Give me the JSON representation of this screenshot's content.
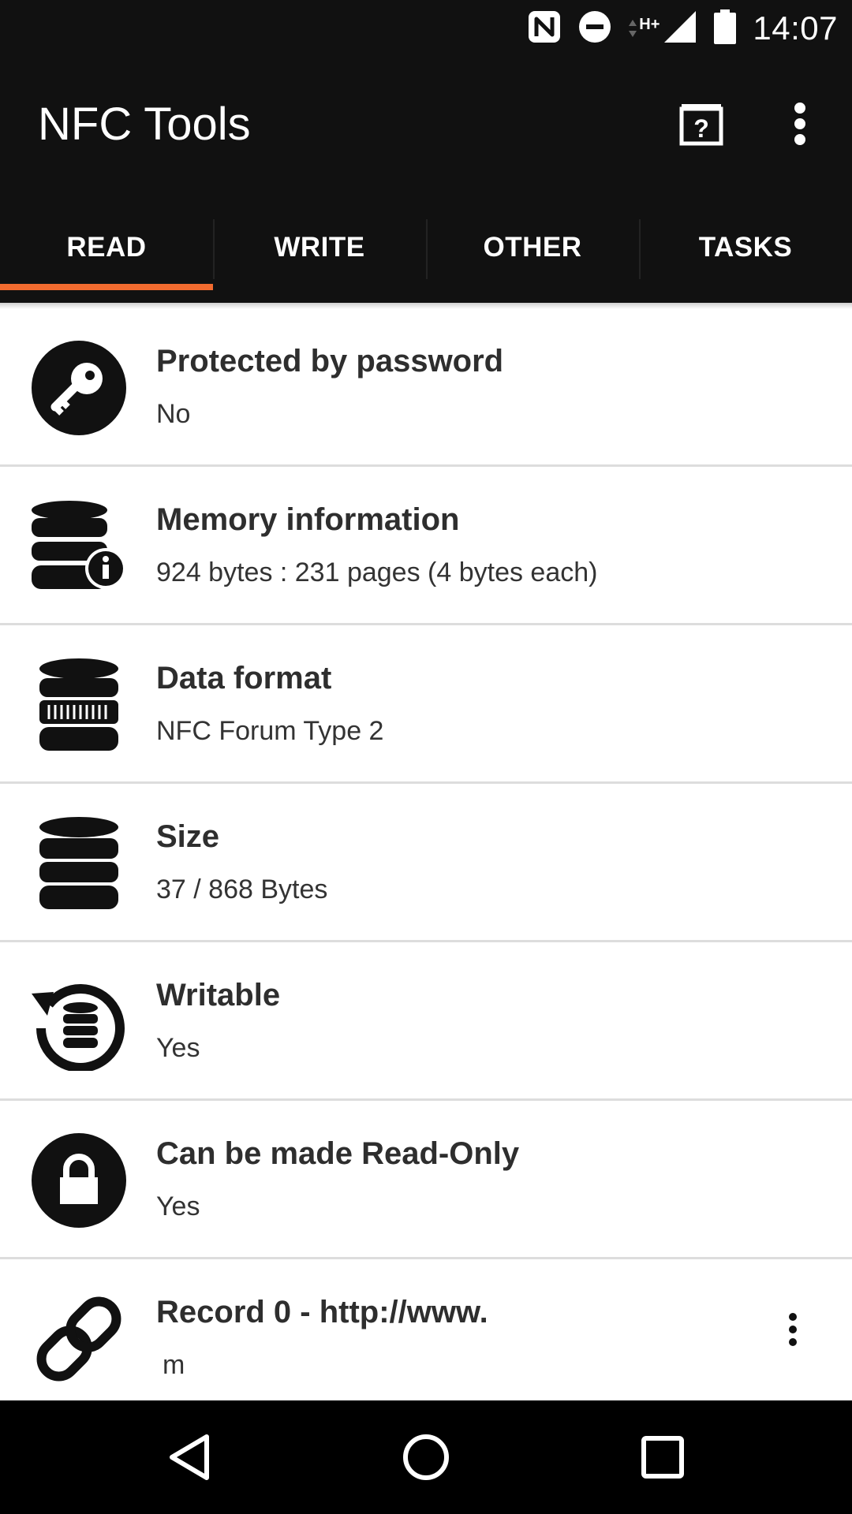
{
  "status_bar": {
    "time": "14:07",
    "network_label": "H+",
    "icons": [
      "nfc-icon",
      "do-not-disturb-icon",
      "data-arrows-icon",
      "signal-icon",
      "battery-icon"
    ]
  },
  "app_bar": {
    "title": "NFC Tools",
    "actions": [
      "help-icon",
      "more-vert-icon"
    ]
  },
  "tabs": [
    {
      "label": "READ",
      "selected": true
    },
    {
      "label": "WRITE",
      "selected": false
    },
    {
      "label": "OTHER",
      "selected": false
    },
    {
      "label": "TASKS",
      "selected": false
    }
  ],
  "accent_color": "#f26b2f",
  "rows": [
    {
      "title": "Protected by password",
      "value": "No",
      "icon": "key-icon"
    },
    {
      "title": "Memory information",
      "value": "924 bytes : 231 pages (4 bytes each)",
      "icon": "database-info-icon"
    },
    {
      "title": "Data format",
      "value": "NFC Forum Type 2",
      "icon": "database-barcode-icon"
    },
    {
      "title": "Size",
      "value": "37 / 868 Bytes",
      "icon": "database-icon"
    },
    {
      "title": "Writable",
      "value": "Yes",
      "icon": "database-refresh-icon"
    },
    {
      "title": "Can be made Read-Only",
      "value": "Yes",
      "icon": "lock-icon"
    },
    {
      "title": "Record 0 - http://www.",
      "value": "m",
      "icon": "link-icon",
      "has_menu": true
    }
  ],
  "nav_bar": [
    "back-icon",
    "home-icon",
    "recents-icon"
  ]
}
